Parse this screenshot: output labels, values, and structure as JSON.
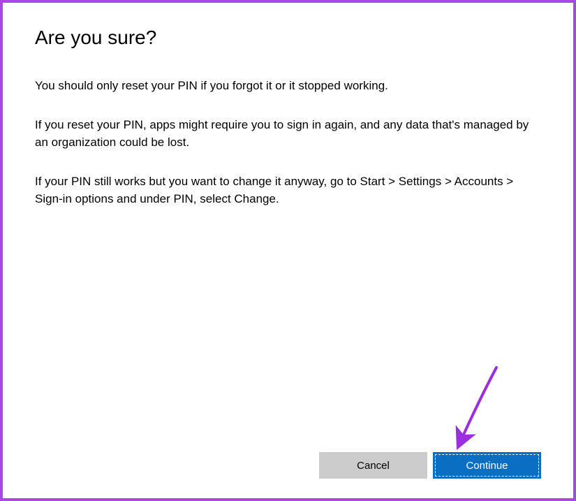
{
  "dialog": {
    "title": "Are you sure?",
    "paragraph1": "You should only reset your PIN if you forgot it or it stopped working.",
    "paragraph2": "If you reset your PIN, apps might require you to sign in again, and any data that's managed by an organization could be lost.",
    "paragraph3": "If your PIN still works but you want to change it anyway, go to Start > Settings > Accounts > Sign-in options and under PIN, select Change."
  },
  "buttons": {
    "cancel": "Cancel",
    "continue": "Continue"
  },
  "colors": {
    "frame_border": "#a846e8",
    "primary_button": "#0a6fc2",
    "secondary_button": "#cccccc",
    "annotation": "#9b2fe0"
  }
}
